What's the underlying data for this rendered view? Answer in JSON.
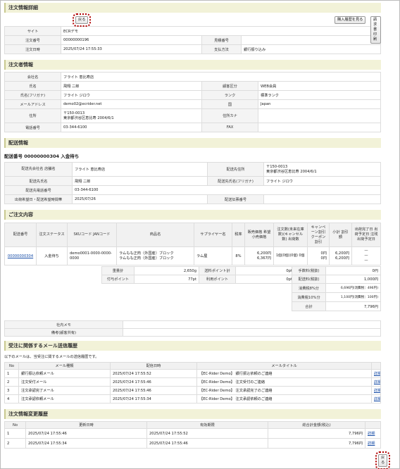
{
  "sections": {
    "order_detail": "注文情報詳細",
    "orderer": "注文者情報",
    "delivery": "配送情報",
    "items": "ご注文内容",
    "mail": "受注に関係するメール送信履歴",
    "history": "注文情報変更履歴"
  },
  "buttons": {
    "back": "戻る",
    "purchase_history": "購入履歴を見る",
    "invoice": "請求書印刷"
  },
  "order": {
    "site_label": "サイト",
    "site": "ECRデモ",
    "order_no_label": "注文番号",
    "order_no": "00000000196",
    "estimate_label": "見積番号",
    "estimate": "",
    "order_date_label": "注文日時",
    "order_date": "2025/07/24 17:55:33",
    "payment_label": "支払方法",
    "payment": "銀行振り込み"
  },
  "customer": {
    "company_label": "会社名",
    "company": "フライト 恵比寿店",
    "name_label": "氏名",
    "name": "飛翔 二郎",
    "kana_label": "氏名(フリガナ)",
    "kana": "フライト ジロウ",
    "email_label": "メールアドレス",
    "email": "demo02@ecrider.net",
    "address_label": "住所",
    "zip": "〒150-0013",
    "address": "東京都渋谷区恵比寿 2004/6/1",
    "tel_label": "電話番号",
    "tel": "03-344-6100",
    "type_label": "顧客区分",
    "type": "WEB会員",
    "rank_label": "ランク",
    "rank": "標準ランク",
    "country_label": "国",
    "country": "Japan",
    "address_kana_label": "住所カナ",
    "address_kana": "",
    "fax_label": "FAX",
    "fax": ""
  },
  "delivery": {
    "title": "配送番号 00000000304 入金待ち",
    "company_label": "配送先会社名 店舗名",
    "company": "フライト 恵比寿店",
    "address_label": "配送先住所",
    "zip": "〒150-0013",
    "address": "東京都渋谷区恵比寿 2004/6/1",
    "name_label": "配送先氏名",
    "name": "飛翔 二郎",
    "kana_label": "配送先氏名(フリガナ)",
    "kana": "フライト ジロウ",
    "tel_label": "配送先電話番号",
    "tel": "03-344-6100",
    "date_label": "出荷希望日・配送希望時間帯",
    "date": "2025/07/26",
    "tracking_label": "配送伝票番号",
    "tracking": ""
  },
  "items": {
    "headers": [
      "配送番号",
      "注文ステータス",
      "SKUコード JANコード",
      "商品名",
      "サプライヤー名",
      "税率",
      "販売価格 希望小売価格",
      "注文数(未来在庫数)(キャンセル数) 出荷数",
      "キャンペーン割引 クーポン割引",
      "小計 割引額",
      "出荷完了日 出荷予定日 注残出荷予定日"
    ],
    "row": {
      "delivery_no": "00000000304",
      "status": "入金待ち",
      "sku": "demo0001-0000-0000-0000",
      "name1": "ラムもも正肉（外国産）ブロック",
      "name2": "ラムもも正肉（外国産）ブロック",
      "supplier": "ラム屋",
      "tax": "8%",
      "price1": "6,200円",
      "price2": "6,367円",
      "qty": "1個(0個)(0個) 0個",
      "disc1": "0円",
      "disc2": "0円",
      "sub1": "6,200円",
      "sub2": "6,200円",
      "ship1": "—",
      "ship2": "—",
      "ship3": "—"
    },
    "summary": {
      "weight_label": "重量計",
      "weight": "2,650g",
      "point_total_label": "送料ポイント計",
      "point_total": "0pt",
      "grant_point_label": "付与ポイント",
      "grant_point": "77pt",
      "use_point_label": "利用ポイント",
      "use_point": "0pt",
      "fee_label": "手数料(税抜)",
      "fee": "0円",
      "shipping_label": "配送料(税抜)",
      "shipping": "1,000円",
      "tax8_label": "消費税8%分",
      "tax8": "6,696円(消費税：496円)",
      "tax10_label": "消費税10%分",
      "tax10": "1,100円(消費税：100円)",
      "total_label": "合計",
      "total": "7,796円"
    },
    "memo_label": "社内メモ",
    "memo": "",
    "note_label": "備考(顧客共有)",
    "note": ""
  },
  "mail": {
    "note": "以下のメールは、当受注に関するメールの送信履歴です。",
    "headers": [
      "No",
      "メール種類",
      "配信日時",
      "メールタイトル",
      ""
    ],
    "rows": [
      {
        "no": "1",
        "type": "銀行振込依頼メール",
        "date": "2025/07/24 17:55:52",
        "title": "【EC-Rider Demo】 銀行振込依頼のご連絡",
        "link": "詳細"
      },
      {
        "no": "2",
        "type": "注文受付メール",
        "date": "2025/07/24 17:55:46",
        "title": "【EC-Rider Demo】 注文受付のご連絡",
        "link": "詳細"
      },
      {
        "no": "3",
        "type": "注文承認完了メール",
        "date": "2025/07/24 17:55:46",
        "title": "【EC-Rider Demo】 注文承認完了のご連絡",
        "link": "詳細"
      },
      {
        "no": "4",
        "type": "注文承認依頼メール",
        "date": "2025/07/24 17:55:34",
        "title": "【EC-Rider Demo】 注文承認依頼のご連絡",
        "link": "詳細"
      }
    ]
  },
  "history": {
    "headers": [
      "No",
      "更新日時",
      "有効期限",
      "総合計金額(税込)",
      ""
    ],
    "rows": [
      {
        "no": "1",
        "updated": "2025/07/24 17:55:46",
        "expiry": "2025/07/24 17:55:52",
        "total": "7,796円",
        "link": "詳細"
      },
      {
        "no": "2",
        "updated": "2025/07/24 17:55:34",
        "expiry": "2025/07/24 17:55:46",
        "total": "7,796円",
        "link": "詳細"
      }
    ]
  },
  "colors": {
    "section_bg": "#f2f2d8",
    "highlight": "#b00000",
    "link": "#1a4fa8"
  }
}
